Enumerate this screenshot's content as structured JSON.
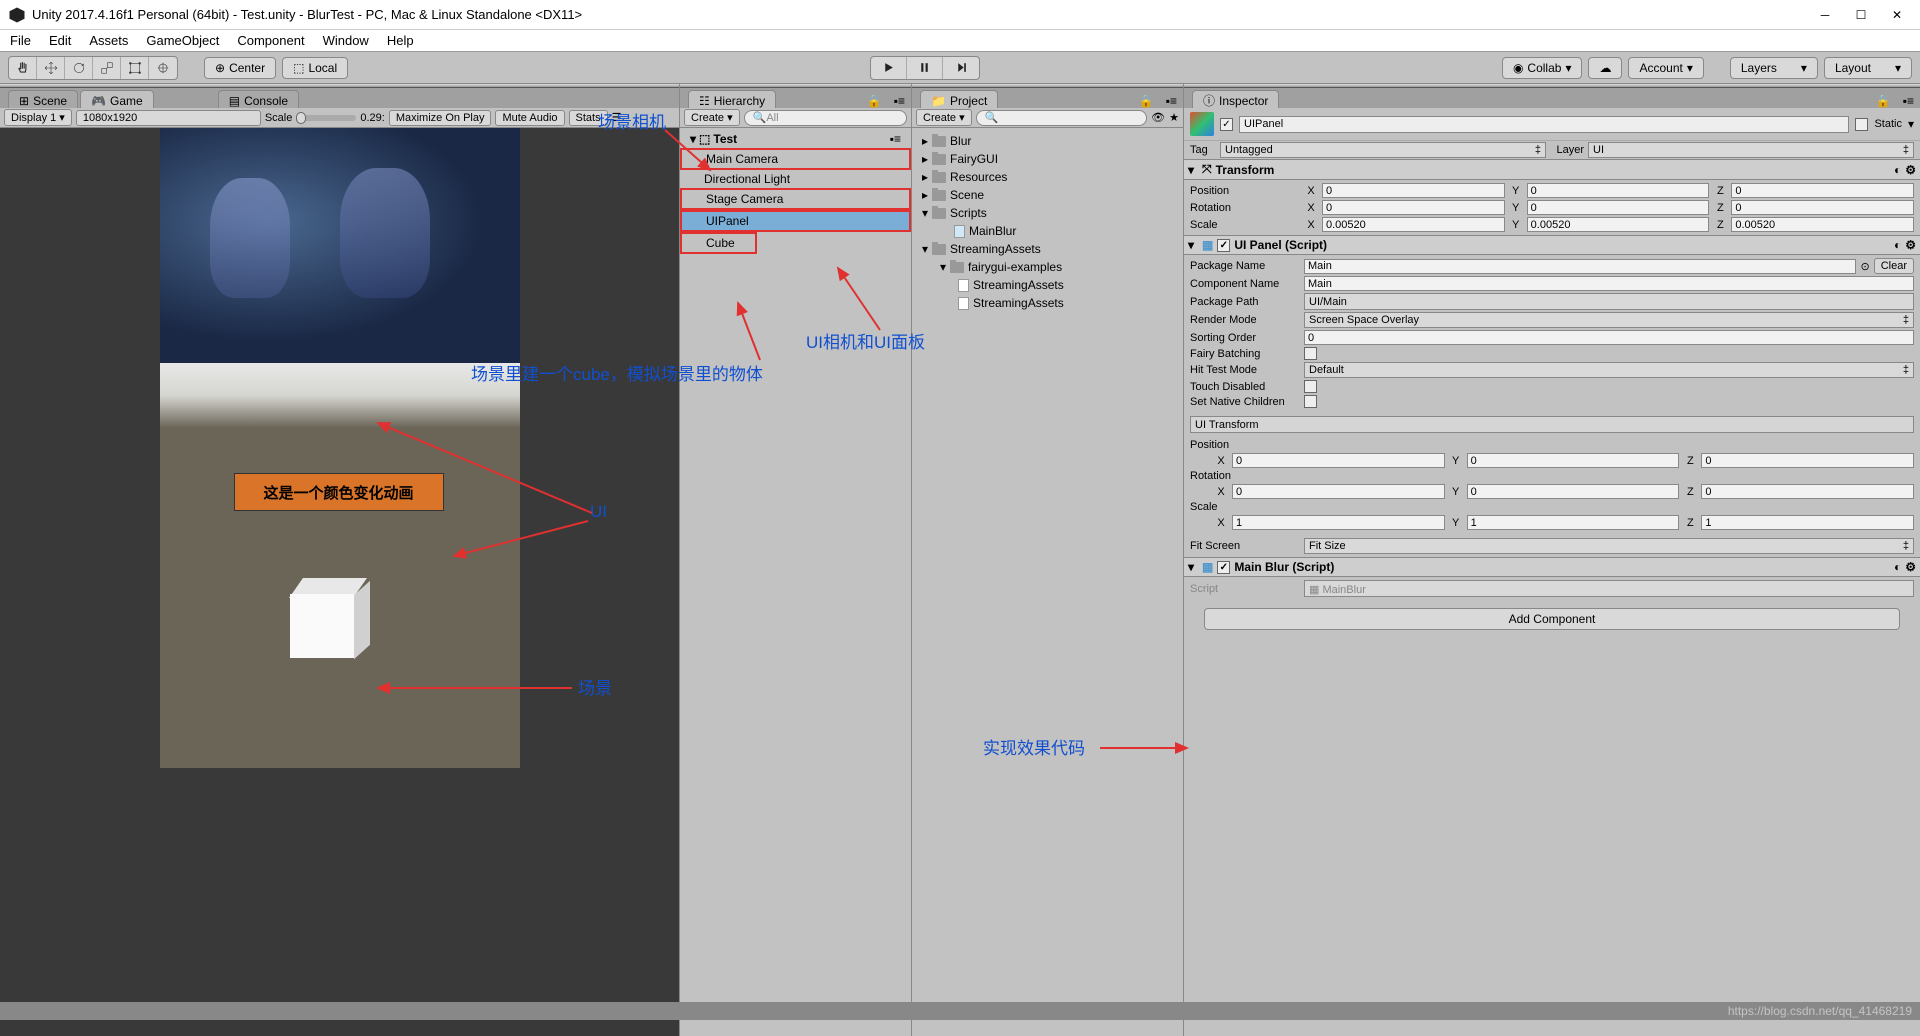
{
  "window": {
    "title": "Unity 2017.4.16f1 Personal (64bit) - Test.unity - BlurTest - PC, Mac & Linux Standalone <DX11>"
  },
  "menu": [
    "File",
    "Edit",
    "Assets",
    "GameObject",
    "Component",
    "Window",
    "Help"
  ],
  "toolbar": {
    "center": "Center",
    "local": "Local",
    "collab": "Collab",
    "account": "Account",
    "layers": "Layers",
    "layout": "Layout"
  },
  "gamepanel": {
    "tabs": {
      "scene": "Scene",
      "game": "Game",
      "console": "Console"
    },
    "display": "Display 1",
    "res": "1080x1920",
    "scale_lbl": "Scale",
    "scale_val": "0.29:",
    "maxplay": "Maximize On Play",
    "mute": "Mute Audio",
    "stats": "Stats",
    "orangebox": "这是一个颜色变化动画"
  },
  "hierarchy": {
    "tab": "Hierarchy",
    "create": "Create",
    "search_ph": "All",
    "scene": "Test",
    "items": [
      "Main Camera",
      "Directional Light",
      "Stage Camera",
      "UIPanel",
      "Cube"
    ]
  },
  "project": {
    "tab": "Project",
    "create": "Create",
    "items": {
      "blur": "Blur",
      "fairygui": "FairyGUI",
      "resources": "Resources",
      "scene": "Scene",
      "scripts": "Scripts",
      "mainblur": "MainBlur",
      "streamingassets": "StreamingAssets",
      "fairyex": "fairygui-examples",
      "streaming2": "StreamingAssets",
      "streaming3": "StreamingAssets"
    }
  },
  "inspector": {
    "tab": "Inspector",
    "name": "UIPanel",
    "static": "Static",
    "tag_lbl": "Tag",
    "tag": "Untagged",
    "layer_lbl": "Layer",
    "layer": "UI",
    "transform": {
      "title": "Transform",
      "pos_lbl": "Position",
      "rot_lbl": "Rotation",
      "scale_lbl": "Scale",
      "pos": {
        "x": "0",
        "y": "0",
        "z": "0"
      },
      "rot": {
        "x": "0",
        "y": "0",
        "z": "0"
      },
      "scale": {
        "x": "0.00520",
        "y": "0.00520",
        "z": "0.00520"
      }
    },
    "uipanel": {
      "title": "UI Panel (Script)",
      "pkg_lbl": "Package Name",
      "pkg": "Main",
      "clear": "Clear",
      "comp_lbl": "Component Name",
      "comp": "Main",
      "path_lbl": "Package Path",
      "path": "UI/Main",
      "render_lbl": "Render Mode",
      "render": "Screen Space Overlay",
      "sort_lbl": "Sorting Order",
      "sort": "0",
      "batch_lbl": "Fairy Batching",
      "hit_lbl": "Hit Test Mode",
      "hit": "Default",
      "touch_lbl": "Touch Disabled",
      "native_lbl": "Set Native Children",
      "uitrans": "UI Transform",
      "upos_lbl": "Position",
      "urot_lbl": "Rotation",
      "uscale_lbl": "Scale",
      "upos": {
        "x": "0",
        "y": "0",
        "z": "0"
      },
      "urot": {
        "x": "0",
        "y": "0",
        "z": "0"
      },
      "uscale": {
        "x": "1",
        "y": "1",
        "z": "1"
      },
      "fit_lbl": "Fit Screen",
      "fit": "Fit Size"
    },
    "mainblur": {
      "title": "Main Blur (Script)",
      "script_lbl": "Script",
      "script": "MainBlur"
    },
    "addcomp": "Add Component"
  },
  "annotations": {
    "scenecam": "场景相机",
    "uicam": "UI相机和UI面板",
    "cubedesc": "场景里建一个cube，模拟场景里的物体",
    "ui": "UI",
    "scene": "场景",
    "codeeffect": "实现效果代码"
  },
  "watermark": "https://blog.csdn.net/qq_41468219"
}
